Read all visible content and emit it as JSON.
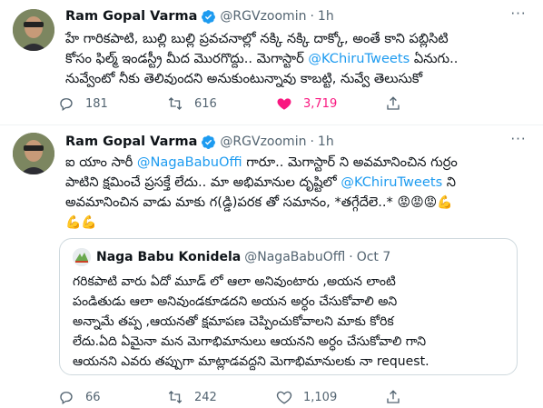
{
  "tweets": [
    {
      "author": "Ram Gopal Varma",
      "handle": "@RGVzoomin",
      "separator": "·",
      "time": "1h",
      "more": "···",
      "lines": [
        [
          {
            "t": "హే గారికపాటి, బుల్లి బుల్లి ప్రవచనాల్లో నక్కి నక్కి దాక్కో, అంతే కాని పబ్లిసిటి"
          }
        ],
        [
          {
            "t": "కోసం ఫిల్మ్ ఇండస్ట్రీ మీద మొరగొద్దు.. మెగాస్టార్ "
          },
          {
            "t": "@KChiruTweets",
            "link": true
          },
          {
            "t": " ఏనుగు.."
          }
        ],
        [
          {
            "t": "నువ్వేంటో నీకు తెలివుందని అనుకుంటున్నావు కాబట్టి,  నువ్వే తెలుసుకో"
          }
        ]
      ],
      "stats": {
        "replies": "181",
        "retweets": "616",
        "likes": "3,719"
      }
    },
    {
      "author": "Ram Gopal Varma",
      "handle": "@RGVzoomin",
      "separator": "·",
      "time": "1h",
      "more": "···",
      "lines": [
        [
          {
            "t": "ఐ యాం సారీ "
          },
          {
            "t": "@NagaBabuOffi",
            "link": true
          },
          {
            "t": " గారూ.. మెగాస్టార్ ని అవమానించిన గుర్రం"
          }
        ],
        [
          {
            "t": "పాటిని క్షమించే ప్రసక్తే లేదు.. మా అభిమానుల దృష్టిలో "
          },
          {
            "t": "@KChiruTweets",
            "link": true
          },
          {
            "t": " ని"
          }
        ],
        [
          {
            "t": "అవమానించిన వాడు మాకు గ(డ్డి)పరక తో సమానం, *తగ్గేదేలె..* "
          },
          {
            "t": "😡😡😡💪",
            "emoji": true
          }
        ],
        [
          {
            "t": "💪💪",
            "emoji": true
          }
        ]
      ],
      "quote": {
        "author": "Naga Babu Konidela",
        "handle": "@NagaBabuOffl",
        "separator": "·",
        "date": "Oct 7",
        "lines": [
          "గరికపాటి వారు ఏదో మూడ్ లో ఆలా అనివుంటారు ,అయన లాంటి",
          "పండితుడు ఆలా అనివుండకూడదని అయన అర్ధం చేసుకోవాలి అని",
          "అన్నామే తప్ప ,ఆయనతో క్షమాపణ చెప్పించుకోవాలని మాకు కోరిక",
          "లేదు.ఏది ఏమైనా మన మెగాభిమానులు ఆయనని అర్ధం చేసుకోవాలి గాని",
          "ఆయనని ఎవరు తప్పుగా మాట్లాడవద్దని మెగాభిమానులకు నా request."
        ]
      },
      "stats": {
        "replies": "66",
        "retweets": "242",
        "likes": "1,109"
      }
    }
  ],
  "icons": {
    "reply": "reply-icon",
    "retweet": "retweet-icon",
    "like": "heart-icon",
    "share": "share-icon",
    "verified": "verified-badge-icon",
    "more": "more-icon"
  },
  "colors": {
    "verified": "#1d9bf0",
    "link": "#1d9bf0",
    "like_active": "#f91880",
    "muted": "#536471"
  }
}
